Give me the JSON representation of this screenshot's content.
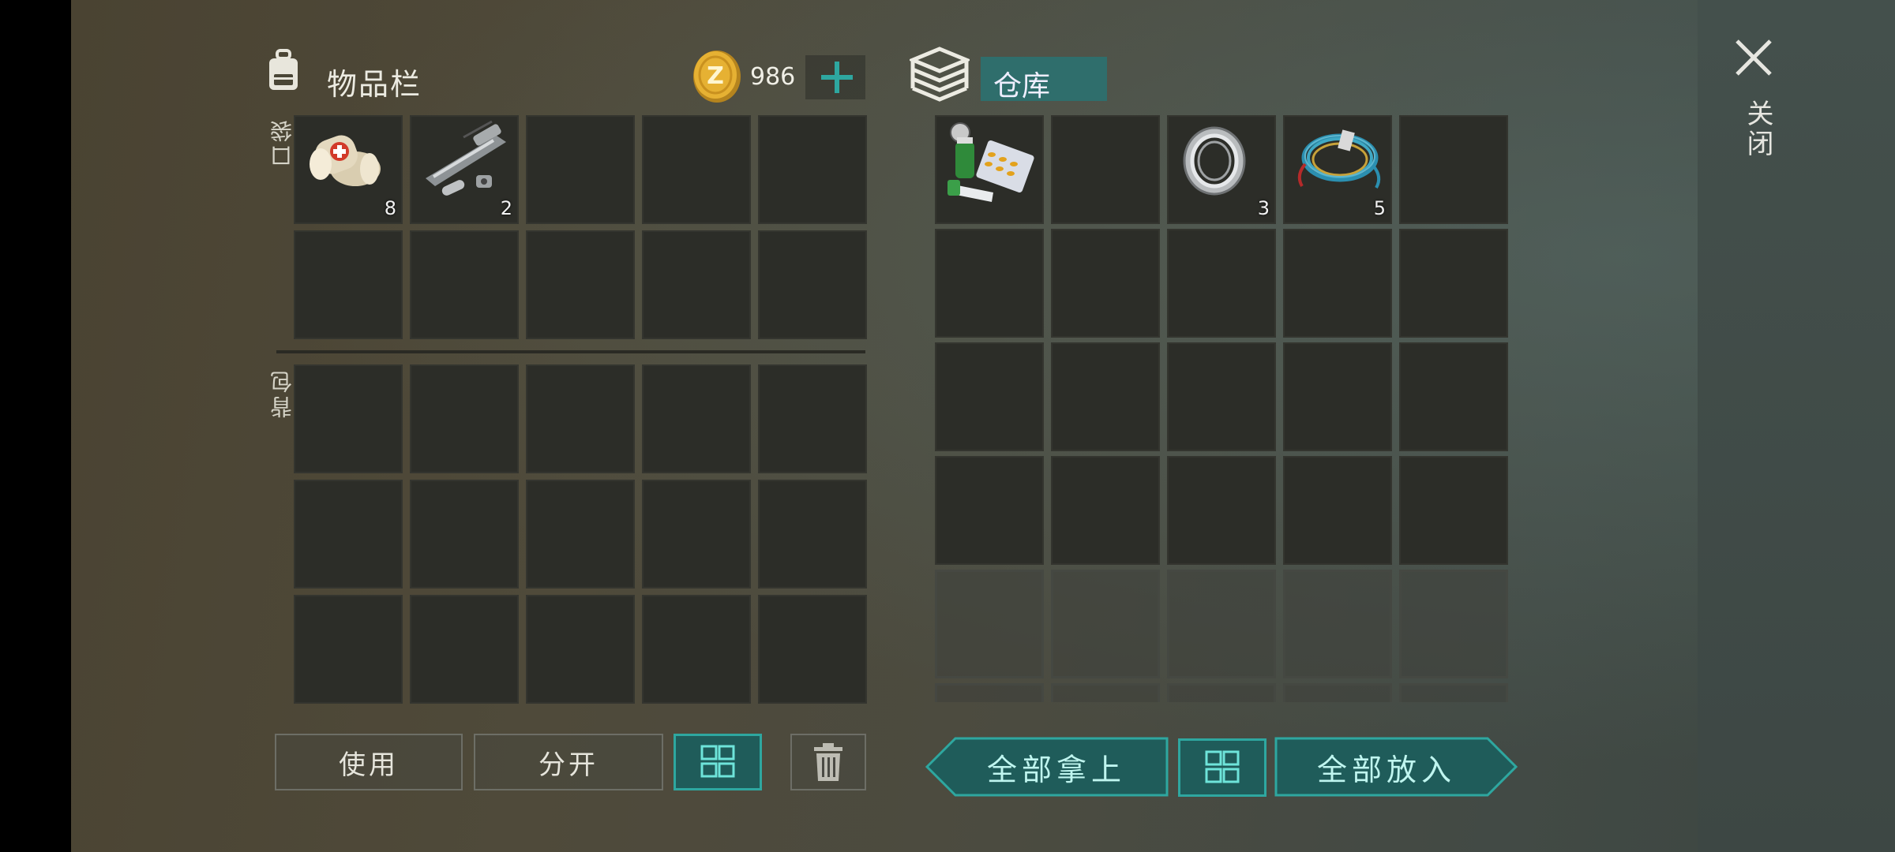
{
  "inventory": {
    "title": "物品栏",
    "coins": "986",
    "pocket_label": "口袋",
    "backpack_label": "背包",
    "pocket_items": [
      {
        "name": "bandage",
        "count": "8"
      },
      {
        "name": "weapon-parts",
        "count": "2"
      }
    ]
  },
  "storage": {
    "title": "仓库",
    "items": [
      {
        "name": "medicine-kit",
        "count": ""
      },
      {
        "name": "bearing",
        "count": "3"
      },
      {
        "name": "wire",
        "count": "5"
      }
    ]
  },
  "buttons": {
    "use": "使用",
    "split": "分开",
    "take_all": "全部拿上",
    "put_all": "全部放入"
  },
  "close_label": "关闭",
  "colors": {
    "teal_accent": "#2ea7a0",
    "teal_fill": "#1f5c5a",
    "slot_bg": "#2c2d28"
  }
}
